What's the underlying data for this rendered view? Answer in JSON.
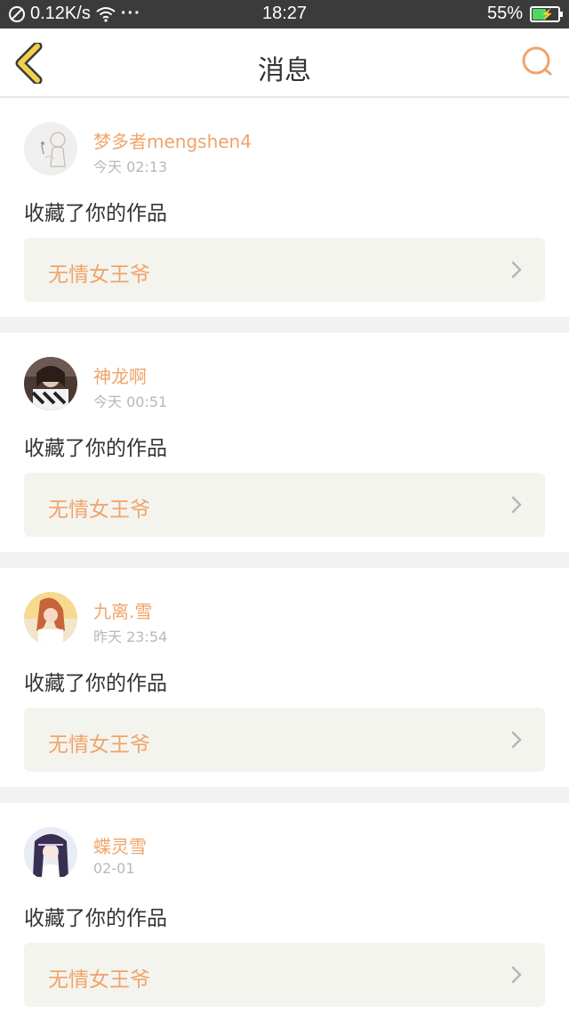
{
  "status_bar": {
    "speed": "0.12K/s",
    "more": "···",
    "time": "18:27",
    "battery_pct": "55%",
    "battery_level": 0.55,
    "icons": [
      "do-not-disturb-icon",
      "wifi-icon",
      "more-icon",
      "battery-charging-icon"
    ]
  },
  "nav": {
    "title": "消息",
    "back_icon": "chevron-left-icon",
    "search_icon": "search-icon"
  },
  "colors": {
    "accent": "#f0a46a",
    "back_icon": "#f0d24a",
    "text": "#333333",
    "muted": "#b8b8b8",
    "card_bg": "#f4f4ef",
    "divider": "#f2f2f2"
  },
  "messages": [
    {
      "user": "梦多者mengshen4",
      "time": "今天 02:13",
      "text": "收藏了你的作品",
      "work": "无情女王爷",
      "avatar": "avatar-sketch"
    },
    {
      "user": "神龙啊",
      "time": "今天 00:51",
      "text": "收藏了你的作品",
      "work": "无情女王爷",
      "avatar": "avatar-photo-dark"
    },
    {
      "user": "九离.雪",
      "time": "昨天 23:54",
      "text": "收藏了你的作品",
      "work": "无情女王爷",
      "avatar": "avatar-photo-girl"
    },
    {
      "user": "蝶灵雪",
      "time": "02-01",
      "text": "收藏了你的作品",
      "work": "无情女王爷",
      "avatar": "avatar-anime"
    }
  ]
}
